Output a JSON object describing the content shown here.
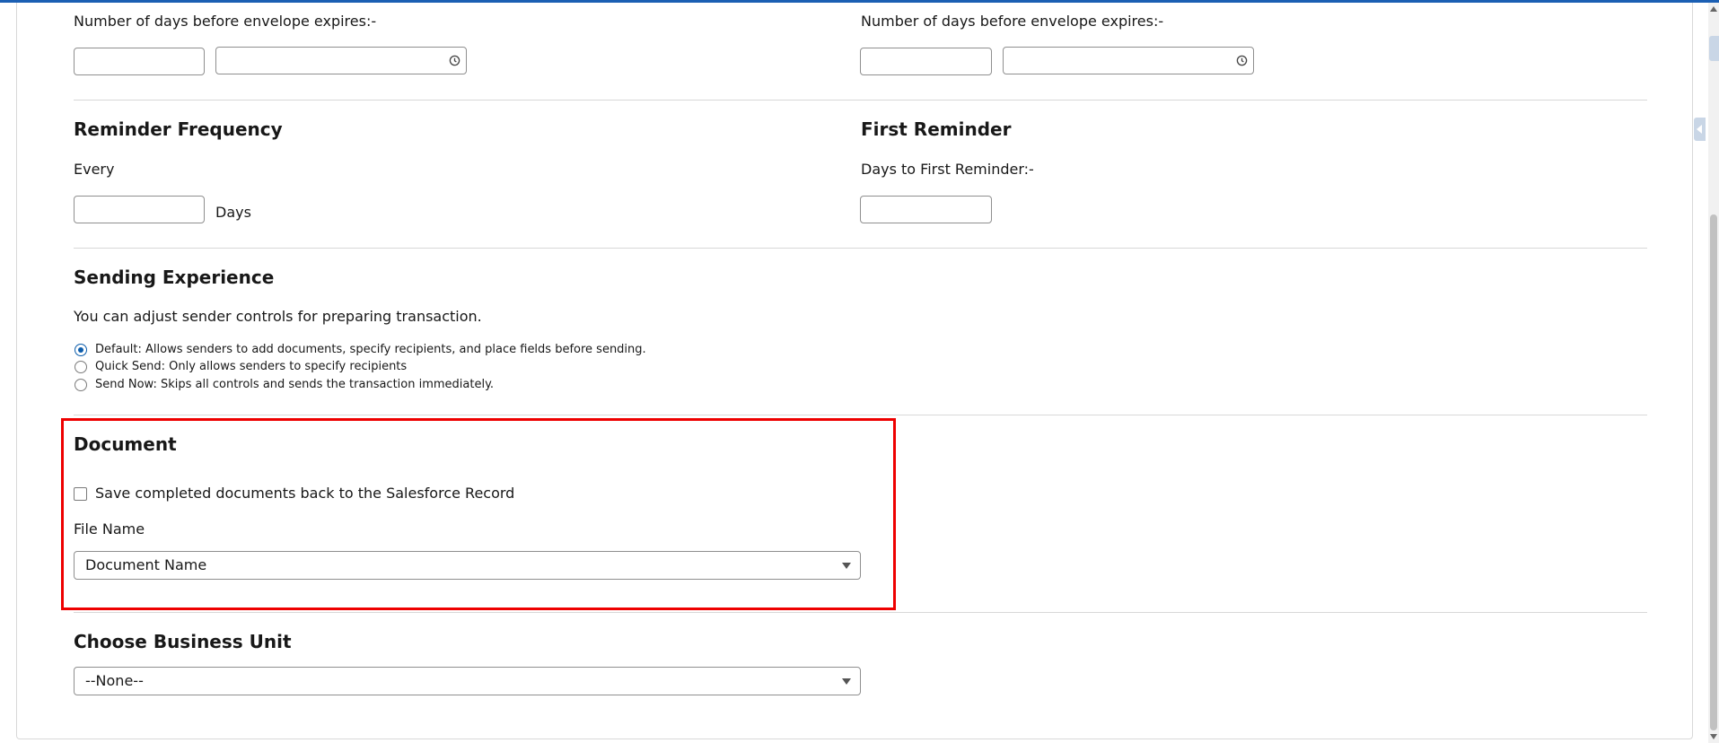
{
  "expiration": {
    "left_label": "Number of days before envelope expires:-",
    "right_label": "Number of days before envelope expires:-",
    "clock_icon": "clock-icon"
  },
  "reminder_frequency": {
    "heading": "Reminder Frequency",
    "every_label": "Every",
    "days_label": "Days"
  },
  "first_reminder": {
    "heading": "First Reminder",
    "label": "Days to First Reminder:-"
  },
  "sending_experience": {
    "heading": "Sending Experience",
    "description": "You can adjust sender controls for preparing transaction.",
    "options": [
      {
        "label": "Default: Allows senders to add documents, specify recipients, and place fields before sending.",
        "selected": true
      },
      {
        "label": "Quick Send: Only allows senders to specify recipients",
        "selected": false
      },
      {
        "label": "Send Now: Skips all controls and sends the transaction immediately.",
        "selected": false
      }
    ]
  },
  "document": {
    "heading": "Document",
    "save_checkbox_label": "Save completed documents back to the Salesforce Record",
    "save_checked": false,
    "file_name_label": "File Name",
    "file_name_value": "Document Name"
  },
  "business_unit": {
    "heading": "Choose Business Unit",
    "value": "--None--"
  },
  "colors": {
    "accent": "#0b5cab",
    "highlight": "#ee0000",
    "divider": "#d8d8d8"
  }
}
